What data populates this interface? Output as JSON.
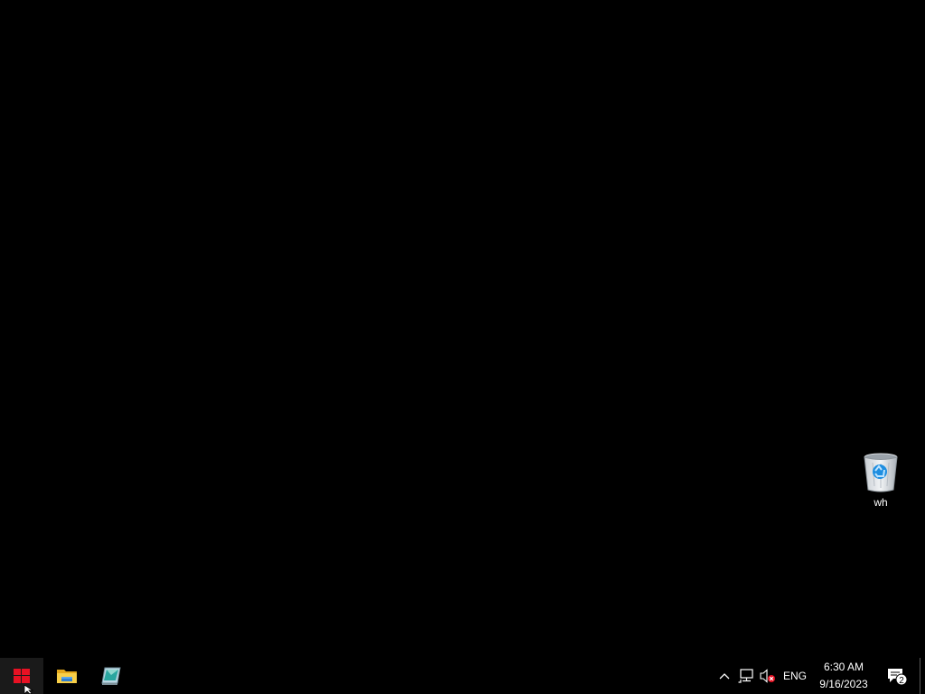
{
  "desktop": {
    "background_color": "#000000",
    "icons": [
      {
        "label": "wh",
        "icon": "recycle-bin-icon"
      }
    ]
  },
  "taskbar": {
    "start": {
      "icon": "windows-logo-icon",
      "accent": "#e81123"
    },
    "pinned": [
      {
        "icon": "file-explorer-icon"
      },
      {
        "icon": "app-icon"
      }
    ],
    "tray": {
      "chevron_icon": "chevron-up-icon",
      "network_icon": "network-icon",
      "volume_icon": "volume-muted-icon",
      "language": "ENG",
      "time": "6:30 AM",
      "date": "9/16/2023",
      "notifications_icon": "action-center-icon",
      "notification_count": "2"
    }
  }
}
